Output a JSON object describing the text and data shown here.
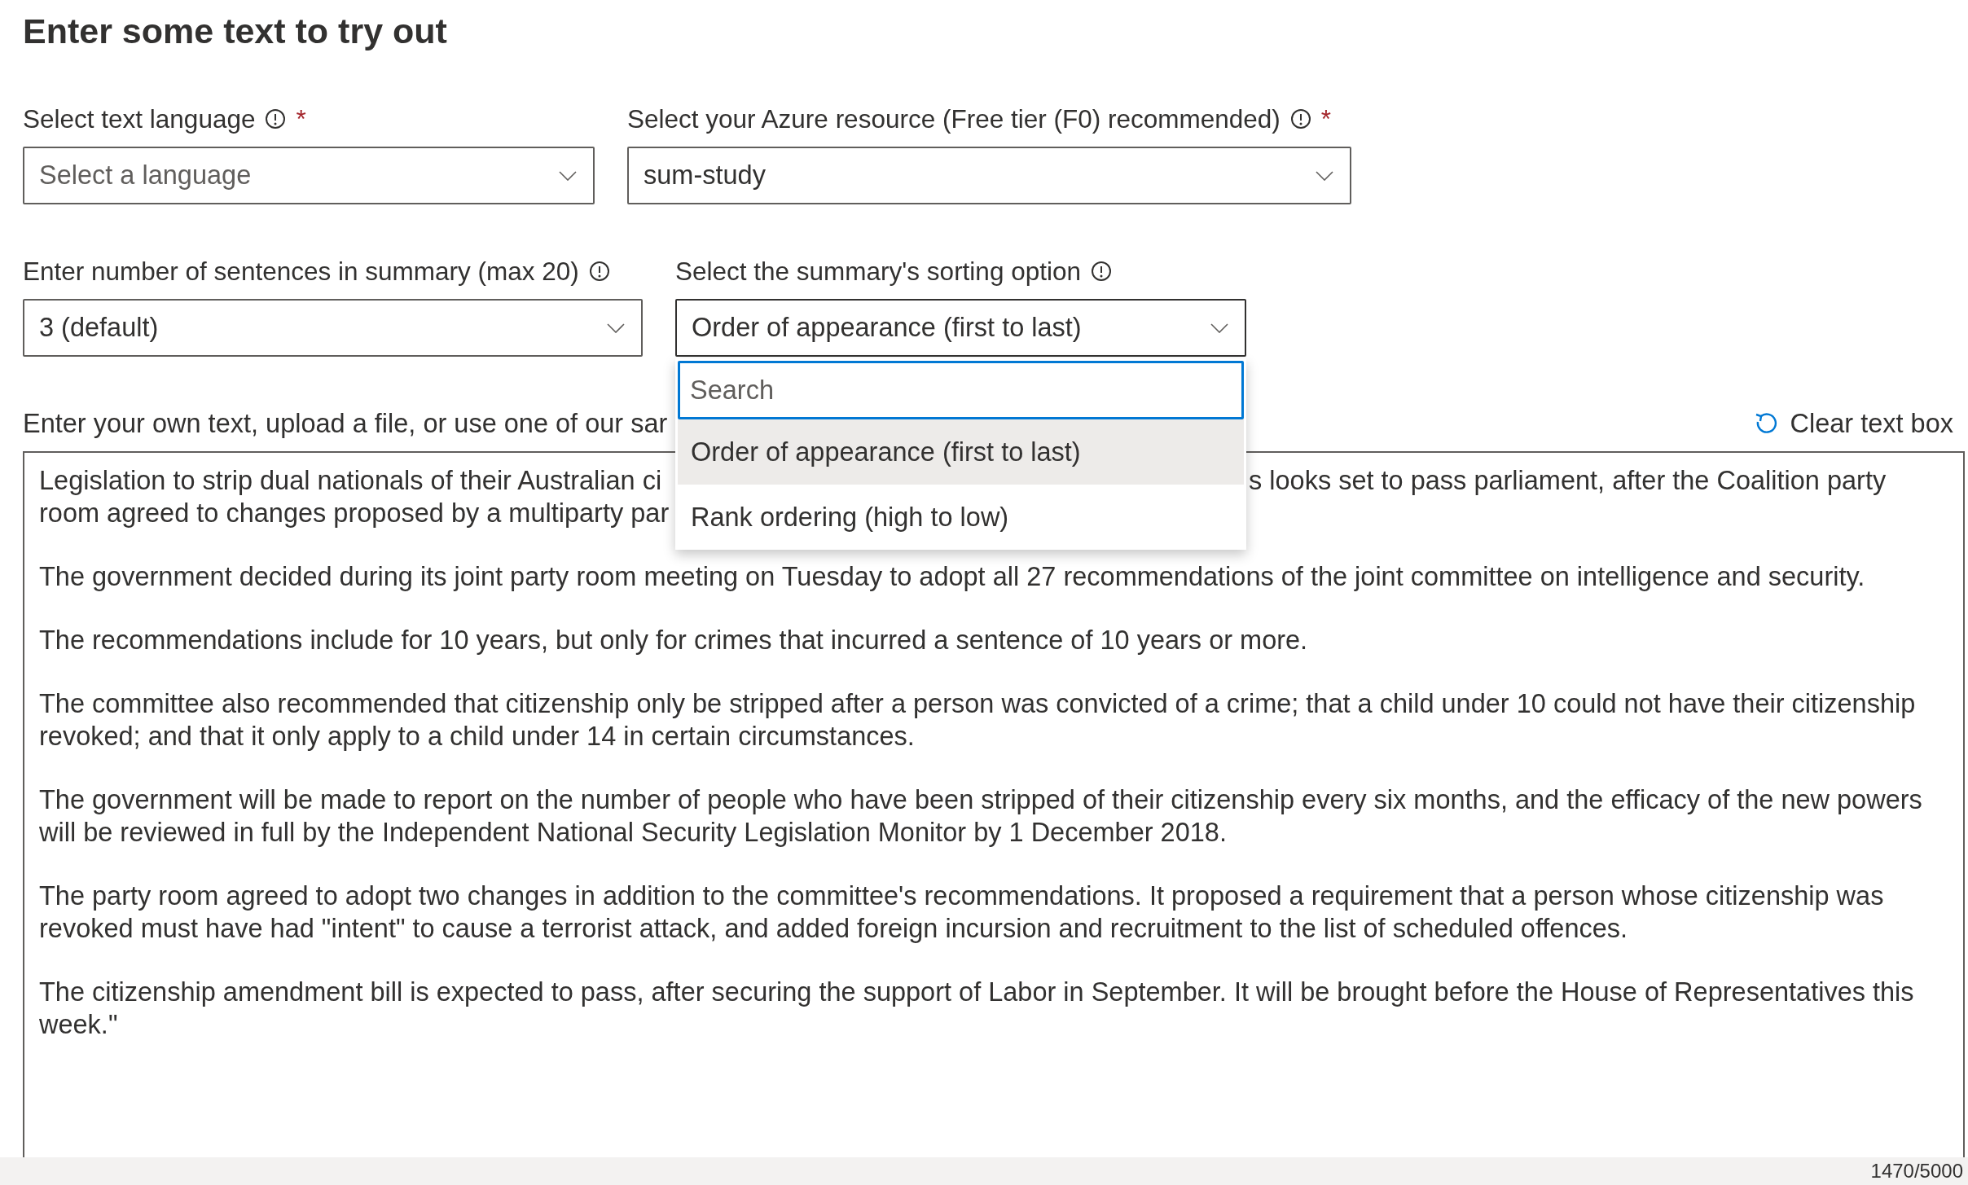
{
  "title": "Enter some text to try out",
  "field_rows": [
    {
      "fields": [
        {
          "label": "Select text language",
          "info": true,
          "required_mark": "*",
          "placeholder": "Select a language",
          "open": false
        },
        {
          "label": "Select your Azure resource (Free tier (F0) recommended)",
          "info": true,
          "required_mark": "*",
          "value": "sum-study",
          "open": false
        }
      ]
    },
    {
      "fields": [
        {
          "label": "Enter number of sentences in summary (max 20)",
          "info": true,
          "value": "3 (default)",
          "open": false
        },
        {
          "label": "Select the summary's sorting option",
          "info": true,
          "value": "Order of appearance (first to last)",
          "open": true,
          "search": {
            "placeholder": "Search"
          },
          "options": [
            {
              "label": "Order of appearance (first to last)",
              "selected": true
            },
            {
              "label": "Rank ordering (high to low)",
              "selected": false
            }
          ]
        }
      ]
    }
  ],
  "text_input": {
    "label": "Enter your own text, upload a file, or use one of our sar",
    "clear_button": "Clear text box",
    "paragraphs": [
      {
        "kind": "split",
        "lines": [
          {
            "left": "Legislation to strip dual nationals of their Australian ci",
            "right": "s looks set to pass parliament, after the Coalition party"
          },
          {
            "left": "room agreed to changes proposed by a multiparty par"
          }
        ]
      },
      {
        "kind": "plain",
        "text": "The government decided during its joint party room meeting on Tuesday to adopt all 27 recommendations of the joint committee on intelligence and security."
      },
      {
        "kind": "plain",
        "text": "The recommendations include  for 10 years, but only for crimes that incurred a sentence of 10 years or more."
      },
      {
        "kind": "plain",
        "text": "The committee also recommended that citizenship only be stripped after a person was convicted of a crime; that a child under 10 could not have their citizenship revoked; and that it only apply to a child under 14 in certain circumstances."
      },
      {
        "kind": "plain",
        "text": "The government will be made to report on the number of people who have been stripped of their citizenship every six months, and the efficacy of the new powers will be reviewed in full by the Independent National Security Legislation Monitor by 1 December 2018."
      },
      {
        "kind": "plain",
        "text": "The party room agreed to adopt two changes in addition to the committee's recommendations. It proposed a requirement that a person whose citizenship was revoked must have had \"intent\" to cause a terrorist attack, and added foreign incursion and recruitment to the list of scheduled offences."
      },
      {
        "kind": "plain",
        "text": "The citizenship amendment bill is expected to pass, after securing the support of Labor in September. It will be brought before the House of Representatives this week.\""
      }
    ],
    "counter": "1470/5000"
  }
}
